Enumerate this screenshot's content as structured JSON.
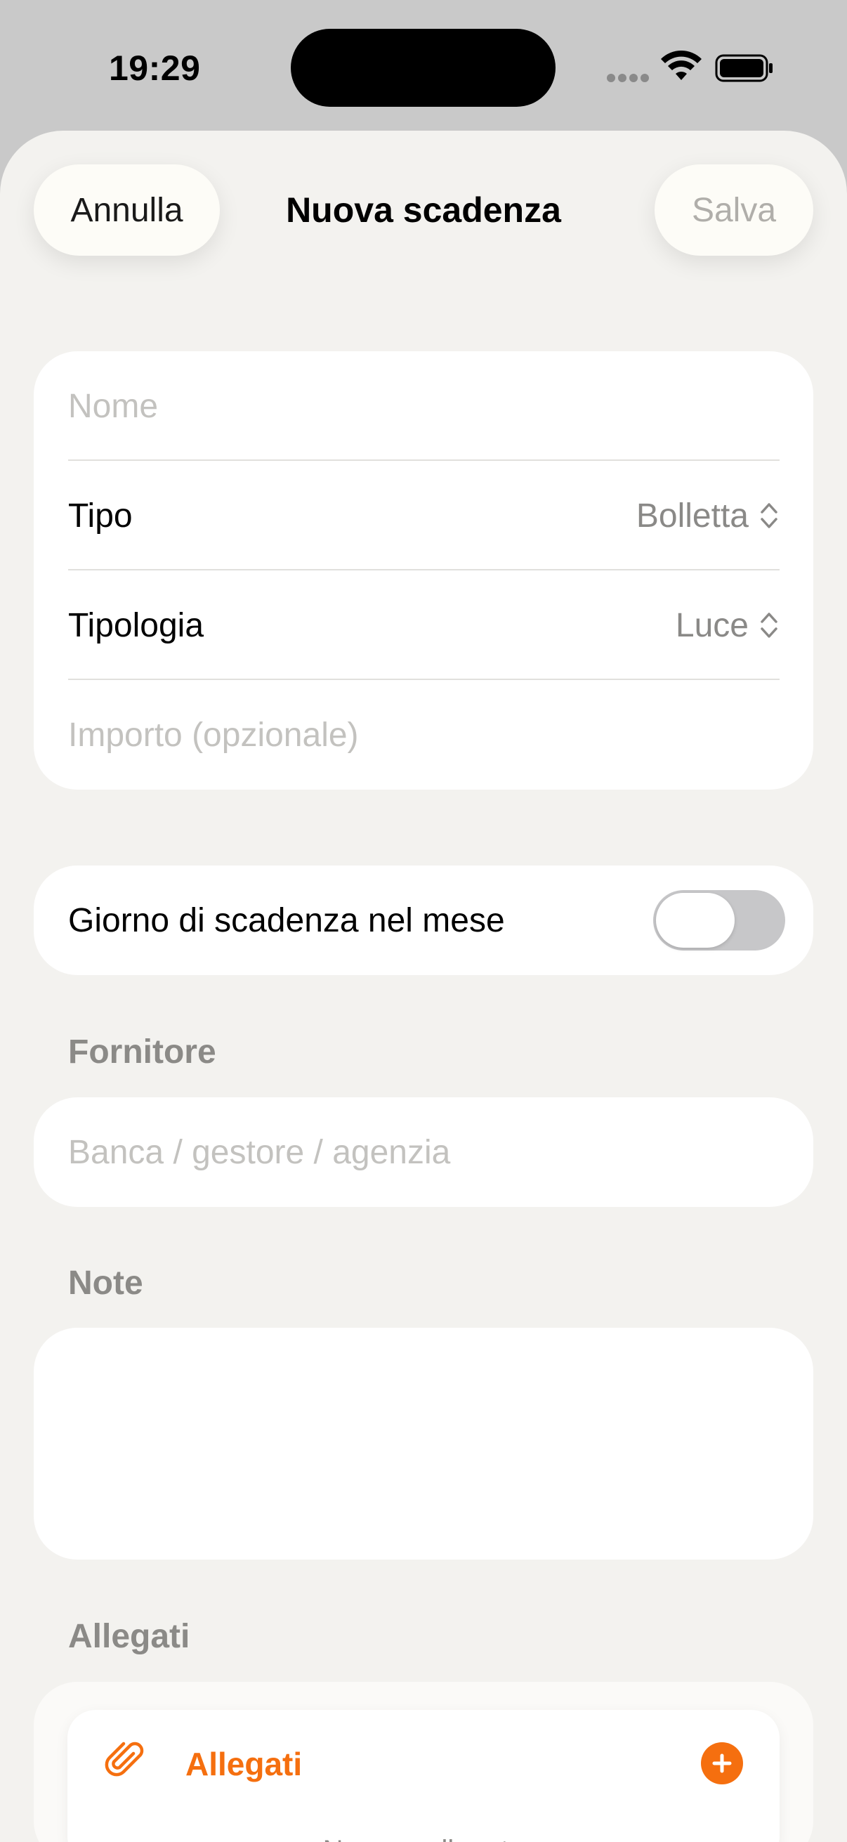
{
  "status_bar": {
    "time": "19:29"
  },
  "nav": {
    "cancel_label": "Annulla",
    "title": "Nuova scadenza",
    "save_label": "Salva"
  },
  "form": {
    "name_placeholder": "Nome",
    "type": {
      "label": "Tipo",
      "value": "Bolletta"
    },
    "category": {
      "label": "Tipologia",
      "value": "Luce"
    },
    "amount_placeholder": "Importo (opzionale)"
  },
  "due_day_toggle": {
    "label": "Giorno di scadenza nel mese",
    "on": false
  },
  "supplier": {
    "section_label": "Fornitore",
    "placeholder": "Banca / gestore / agenzia"
  },
  "notes": {
    "section_label": "Note",
    "value": ""
  },
  "attachments": {
    "section_label": "Allegati",
    "title": "Allegati",
    "empty_text": "Nessun allegato"
  },
  "colors": {
    "accent": "#f56f0f",
    "background": "#f3f2ef",
    "card": "#ffffff",
    "placeholder": "#c3c2bf",
    "secondary_text": "#8b8a87"
  },
  "icons": [
    "wifi-icon",
    "battery-icon",
    "updown-chevron-icon",
    "paperclip-icon",
    "plus-icon"
  ]
}
